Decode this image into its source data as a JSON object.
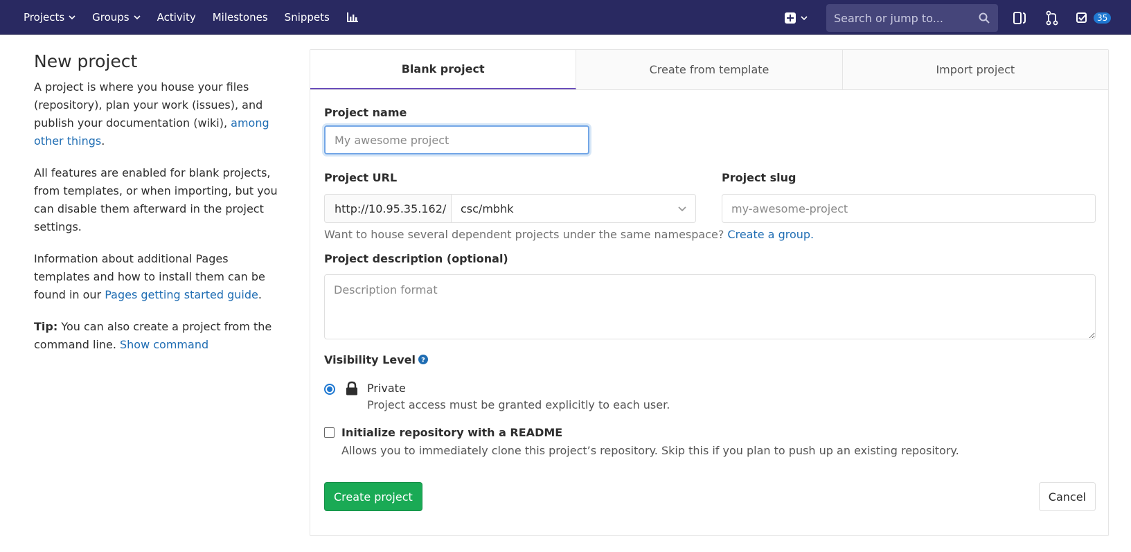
{
  "nav": {
    "items": [
      {
        "label": "Projects",
        "dropdown": true
      },
      {
        "label": "Groups",
        "dropdown": true
      },
      {
        "label": "Activity",
        "dropdown": false
      },
      {
        "label": "Milestones",
        "dropdown": false
      },
      {
        "label": "Snippets",
        "dropdown": false
      }
    ],
    "search_placeholder": "Search or jump to...",
    "todo_count": "35",
    "icons": [
      "chart-icon",
      "plus-square-icon",
      "search-icon",
      "issues-icon",
      "merge-request-icon",
      "todo-icon"
    ],
    "colors": {
      "navbar": "#292961",
      "accent": "#1f78d1",
      "create": "#1aaa55",
      "tab_active": "#6b4fbb"
    }
  },
  "info": {
    "title": "New project",
    "p1_text": "A project is where you house your files (repository), plan your work (issues), and publish your documentation (wiki), ",
    "p1_link": "among other things",
    "p1_end": ".",
    "p2": "All features are enabled for blank projects, from templates, or when importing, but you can disable them afterward in the project settings.",
    "p3_text": "Information about additional Pages templates and how to install them can be found in our ",
    "p3_link": "Pages getting started guide",
    "p3_end": ".",
    "tip_label": "Tip:",
    "tip_text": " You can also create a project from the command line. ",
    "tip_link": "Show command"
  },
  "tabs": [
    {
      "label": "Blank project",
      "active": true
    },
    {
      "label": "Create from template",
      "active": false
    },
    {
      "label": "Import project",
      "active": false
    }
  ],
  "form": {
    "name_label": "Project name",
    "name_placeholder": "My awesome project",
    "url_label": "Project URL",
    "url_prefix": "http://10.95.35.162/",
    "namespace": "csc/mbhk",
    "slug_label": "Project slug",
    "slug_placeholder": "my-awesome-project",
    "help_text": "Want to house several dependent projects under the same namespace? ",
    "help_link": "Create a group.",
    "desc_label": "Project description (optional)",
    "desc_placeholder": "Description format",
    "visibility_label": "Visibility Level",
    "visibility_title": "Private",
    "visibility_desc": "Project access must be granted explicitly to each user.",
    "readme_title": "Initialize repository with a README",
    "readme_desc": "Allows you to immediately clone this project’s repository. Skip this if you plan to push up an existing repository.",
    "create_label": "Create project",
    "cancel_label": "Cancel"
  }
}
